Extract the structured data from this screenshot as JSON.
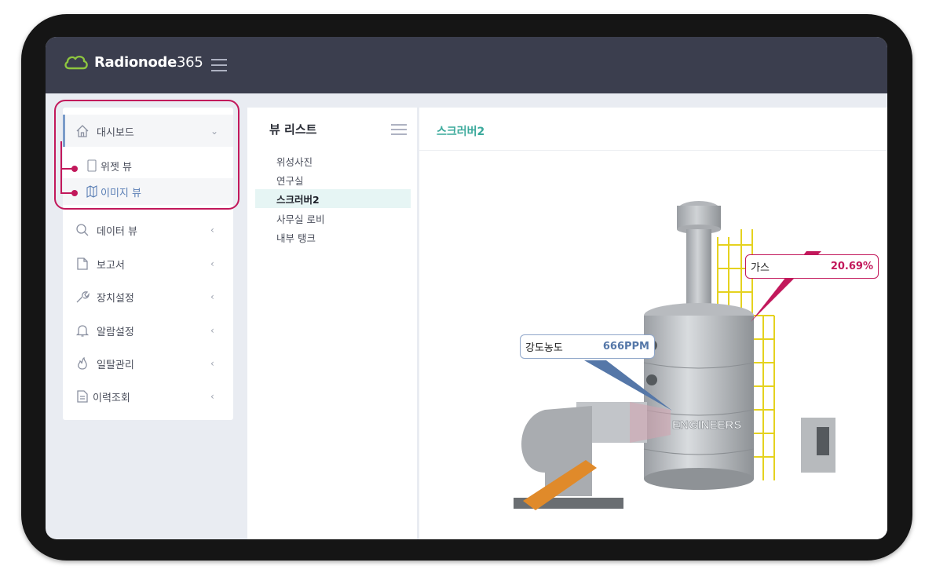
{
  "app": {
    "logo_text": "Radionode",
    "logo_num": "365"
  },
  "sidebar": {
    "items": [
      {
        "label": "대시보드",
        "icon": "home-icon"
      },
      {
        "label": "데이터 뷰",
        "icon": "search-icon"
      },
      {
        "label": "보고서",
        "icon": "document-icon"
      },
      {
        "label": "장치설정",
        "icon": "wrench-icon"
      },
      {
        "label": "알람설정",
        "icon": "bell-icon"
      },
      {
        "label": "일탈관리",
        "icon": "flame-icon"
      },
      {
        "label": "이력조회",
        "icon": "list-icon"
      }
    ],
    "sub_items": [
      {
        "label": "위젯 뷰",
        "icon": "tablet-icon"
      },
      {
        "label": "이미지 뷰",
        "icon": "map-icon"
      }
    ]
  },
  "view_list": {
    "title": "뷰 리스트",
    "items": [
      {
        "label": "위성사진"
      },
      {
        "label": "연구실"
      },
      {
        "label": "스크러버2"
      },
      {
        "label": "사무실 로비"
      },
      {
        "label": "내부 탱크"
      }
    ],
    "active": "스크러버2"
  },
  "main": {
    "title": "스크러버2",
    "image_text": "ENGINEERS",
    "callouts": [
      {
        "label": "가스",
        "value": "20.69%",
        "color": "#c2185b"
      },
      {
        "label": "강도농도",
        "value": "666PPM",
        "color": "#5577a8"
      }
    ]
  },
  "colors": {
    "topbar": "#3b3e4e",
    "accent": "#3aa99b",
    "highlight": "#c2185b"
  }
}
